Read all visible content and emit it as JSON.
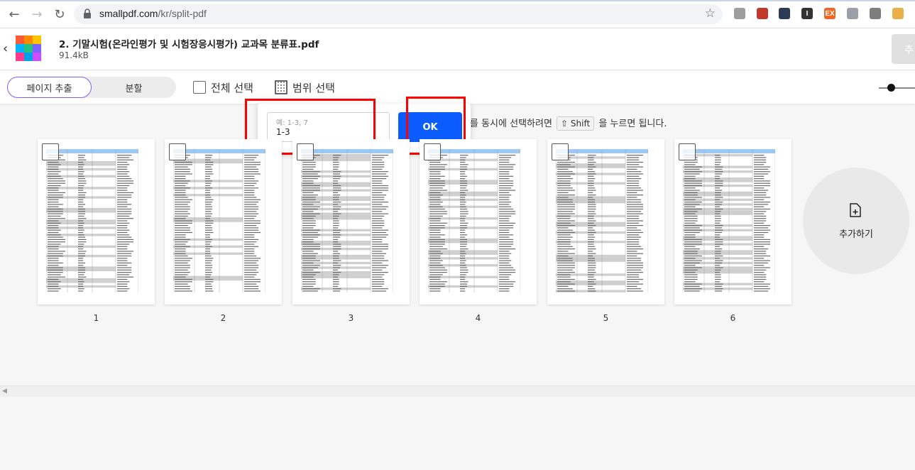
{
  "browser": {
    "url_domain": "smallpdf.com",
    "url_path": "/kr/split-pdf",
    "extensions": [
      {
        "name": "monitor-icon",
        "color": "#9e9e9e",
        "glyph": ""
      },
      {
        "name": "pdf-icon",
        "color": "#c0392b",
        "glyph": ""
      },
      {
        "name": "circle-logo-icon",
        "color": "#2b3a55",
        "glyph": ""
      },
      {
        "name": "i-extension-icon",
        "color": "#333333",
        "glyph": "I"
      },
      {
        "name": "ex-extension-icon",
        "color": "#f26522",
        "glyph": "EX"
      },
      {
        "name": "shield-icon",
        "color": "#9aa0a6",
        "glyph": ""
      },
      {
        "name": "window-icon",
        "color": "#7d7d7d",
        "glyph": ""
      },
      {
        "name": "avatar-icon",
        "color": "#e8b04a",
        "glyph": ""
      }
    ]
  },
  "header": {
    "file_name": "2. 기말시험(온라인평가 및 시험장응시평가) 교과목 분류표.pdf",
    "file_size": "91.4kB",
    "right_button_label": "추"
  },
  "toolbar": {
    "mode_extract": "페이지 추출",
    "mode_split": "분할",
    "select_all": "전체 선택",
    "range_select": "범위 선택"
  },
  "range_popup": {
    "placeholder": "예: 1-3, 7",
    "value": "1-3",
    "ok_label": "OK"
  },
  "hint": {
    "before": "를 동시에 선택하려면",
    "key": "⇧ Shift",
    "after": "을 누르면 됩니다."
  },
  "pages": [
    {
      "number": "1"
    },
    {
      "number": "2"
    },
    {
      "number": "3"
    },
    {
      "number": "4"
    },
    {
      "number": "5"
    },
    {
      "number": "6"
    }
  ],
  "add_more_label": "추가하기",
  "colors": {
    "accent": "#0a5cff",
    "segment_border": "#7b61ff",
    "highlight": "#ff0000"
  }
}
